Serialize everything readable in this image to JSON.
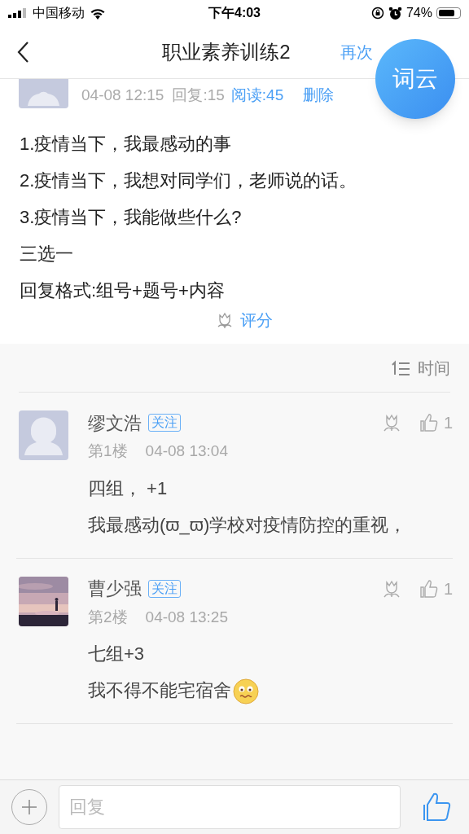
{
  "status_bar": {
    "carrier": "中国移动",
    "time": "下午4:03",
    "battery": "74%"
  },
  "nav": {
    "title": "职业素养训练2",
    "action": "再次"
  },
  "fab": {
    "label": "词云"
  },
  "post": {
    "time": "04-08 12:15",
    "replies": "回复:15",
    "reads": "阅读:45",
    "delete": "删除",
    "lines": [
      "1.疫情当下，我最感动的事",
      "2.疫情当下，我想对同学们，老师说的话。",
      "3.疫情当下，我能做些什么?",
      "三选一",
      "回复格式:组号+题号+内容"
    ],
    "rate": "评分"
  },
  "sort": {
    "label": "时间"
  },
  "comments": [
    {
      "name": "缪文浩",
      "follow": "关注",
      "floor": "第1楼",
      "time": "04-08 13:04",
      "likes": "1",
      "avatar": {
        "kind": "default"
      },
      "lines": [
        {
          "text": "四组，  +1",
          "emoji": false
        },
        {
          "text": "我最感动(ϖ_ϖ)学校对疫情防控的重视，",
          "emoji": false
        }
      ]
    },
    {
      "name": "曹少强",
      "follow": "关注",
      "floor": "第2楼",
      "time": "04-08 13:25",
      "likes": "1",
      "lines": [
        {
          "text": "七组+3",
          "emoji": false
        },
        {
          "text": "我不得不能宅宿舍",
          "emoji": true
        }
      ]
    }
  ],
  "reply": {
    "placeholder": "回复"
  }
}
